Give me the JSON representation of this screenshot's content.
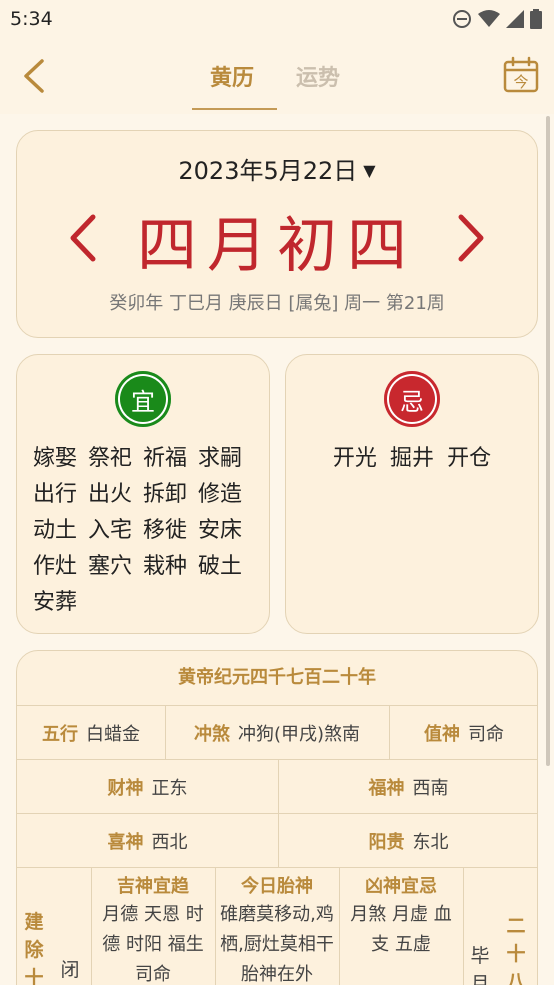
{
  "status_bar": {
    "time": "5:34"
  },
  "header": {
    "tabs": [
      "黄历",
      "运势"
    ],
    "today_icon_label": "今"
  },
  "date_card": {
    "date": "2023年5月22日",
    "lunar": "四月初四",
    "ganzhi": "癸卯年 丁巳月 庚辰日 [属兔] 周一 第21周"
  },
  "yi": {
    "badge": "宜",
    "items": [
      "嫁娶",
      "祭祀",
      "祈福",
      "求嗣",
      "出行",
      "出火",
      "拆卸",
      "修造",
      "动土",
      "入宅",
      "移徙",
      "安床",
      "作灶",
      "塞穴",
      "栽种",
      "破土",
      "安葬"
    ]
  },
  "ji": {
    "badge": "忌",
    "items": [
      "开光",
      "掘井",
      "开仓"
    ]
  },
  "almanac": {
    "title": "黄帝纪元四千七百二十年",
    "wuxing": {
      "label": "五行",
      "value": "白蜡金"
    },
    "chongsha": {
      "label": "冲煞",
      "value": "冲狗(甲戌)煞南"
    },
    "zhishen": {
      "label": "值神",
      "value": "司命"
    },
    "caishen": {
      "label": "财神",
      "value": "正东"
    },
    "fushen": {
      "label": "福神",
      "value": "西南"
    },
    "xishen": {
      "label": "喜神",
      "value": "西北"
    },
    "yanggui": {
      "label": "阳贵",
      "value": "东北"
    },
    "jianchu_label": [
      "建",
      "除",
      "十"
    ],
    "jianchu_value": "闭",
    "jishen": {
      "label": "吉神宜趋",
      "value": "月德 天恩 时德 时阳 福生 司命"
    },
    "taishen": {
      "label": "今日胎神",
      "value": "碓磨莫移动,鸡栖,厨灶莫相干胎神在外"
    },
    "xiongshen": {
      "label": "凶神宜忌",
      "value": "月煞 月虚 血支 五虚"
    },
    "xingxiu_a": [
      "毕",
      "月"
    ],
    "xingxiu_b": [
      "二",
      "十",
      "八"
    ]
  }
}
